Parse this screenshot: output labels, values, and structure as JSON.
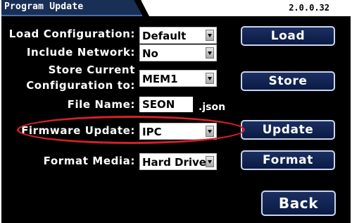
{
  "header": {
    "title": "Program Update",
    "version": "2.0.0.32"
  },
  "form": {
    "load_configuration": {
      "label": "Load Configuration:",
      "value": "Default"
    },
    "include_network": {
      "label": "Include Network:",
      "value": "No"
    },
    "store_current": {
      "label_line1": "Store Current",
      "label_line2": "Configuration to:",
      "value": "MEM1"
    },
    "file_name": {
      "label": "File Name:",
      "value": "SEON",
      "suffix": ".json"
    },
    "firmware_update": {
      "label": "Firmware Update:",
      "value": "IPC"
    },
    "format_media": {
      "label": "Format Media:",
      "value": "Hard Drive"
    }
  },
  "buttons": {
    "load": "Load",
    "store": "Store",
    "update": "Update",
    "format": "Format",
    "back": "Back"
  },
  "colors": {
    "highlight_oval": "#d6202a",
    "button_bg": "#1b2f61",
    "title_tab": "#1a2f55"
  }
}
